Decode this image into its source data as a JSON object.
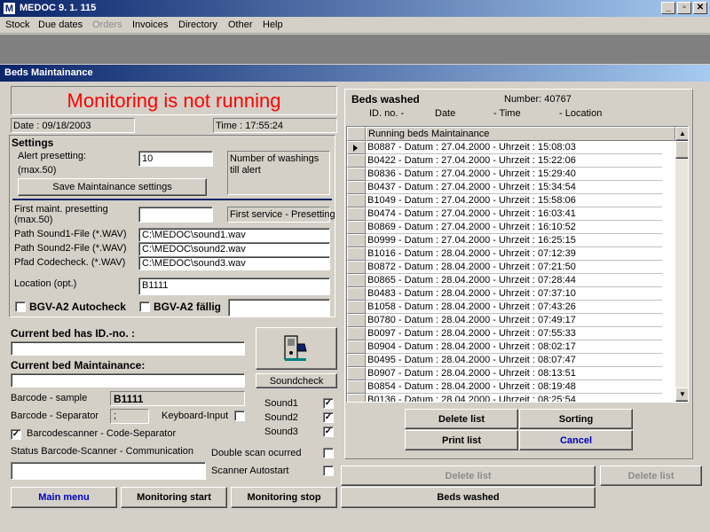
{
  "app": {
    "title": "MEDOC    9. 1. 115",
    "icon": "medoc-app-icon"
  },
  "window_controls": {
    "minimize": "_",
    "maximize": "▫",
    "close": "✕"
  },
  "menu": [
    "Stock",
    "Due dates",
    "Orders",
    "Invoices",
    "Directory",
    "Other",
    "Help"
  ],
  "menu_disabled": [
    "Orders"
  ],
  "form_title": "Beds Maintainance",
  "monitor_status": "Monitoring is not running",
  "monitor_status_color": "#ff0000",
  "date": "Date : 09/18/2003",
  "time": "Time : 17:55:24",
  "settings": {
    "header": "Settings",
    "alert_label_1": "Alert presetting:",
    "alert_label_2": "(max.50)",
    "alert_value": "10",
    "alert_note": "Number of washings till alert",
    "save_button": "Save Maintainance settings",
    "first_maint_label_1": "First maint. presetting",
    "first_maint_label_2": "(max.50)",
    "first_maint_value": "",
    "first_service_note": "First service - Presetting",
    "sound1_label": "Path Sound1-File (*.WAV)",
    "sound1_value": "C:\\MEDOC\\sound1.wav",
    "sound2_label": "Path Sound2-File (*.WAV)",
    "sound2_value": "C:\\MEDOC\\sound2.wav",
    "codecheck_label": "Pfad Codecheck. (*.WAV)",
    "codecheck_value": "C:\\MEDOC\\sound3.wav",
    "location_label": "Location (opt.)",
    "location_value": "B1111",
    "bgv_autocheck": "BGV-A2 Autocheck",
    "bgv_faellig": "BGV-A2 fällig",
    "bgv_faellig_value": ""
  },
  "current": {
    "bed_id_label": "Current bed has ID.-no. :",
    "bed_id_value": "",
    "maint_label": "Current bed Maintainance:",
    "maint_value": "",
    "soundcheck_button": "Soundcheck",
    "barcode_sample_label": "Barcode - sample",
    "barcode_sample_value": "B1111",
    "barcode_sep_label": "Barcode - Separator",
    "barcode_sep_value": ";",
    "keyboard_input_label": "Keyboard-Input",
    "barcodescanner_label": "Barcodescanner - Code-Separator",
    "sound1": "Sound1",
    "sound2": "Sound2",
    "sound3": "Sound3",
    "status_label": "Status Barcode-Scanner - Communication",
    "status_value": "",
    "double_scan_label": "Double scan ocurred",
    "scanner_autostart_label": "Scanner Autostart"
  },
  "bottom_buttons": {
    "main_menu": "Main menu",
    "monitoring_start": "Monitoring start",
    "monitoring_stop": "Monitoring stop",
    "beds_washed": "Beds washed",
    "delete_list_1": "Delete list",
    "delete_list_2": "Delete list"
  },
  "washed": {
    "header": "Beds washed",
    "number_label": "Number: 40767",
    "col_id": "ID. no. -",
    "col_date": "Date",
    "col_time": "- Time",
    "col_location": "- Location",
    "list_header": "Running beds Maintainance",
    "rows": [
      "B0887 - Datum : 27.04.2000 - Uhrzeit : 15:08:03",
      "B0422 - Datum : 27.04.2000 - Uhrzeit : 15:22:06",
      "B0836 - Datum : 27.04.2000 - Uhrzeit : 15:29:40",
      "B0437 - Datum : 27.04.2000 - Uhrzeit : 15:34:54",
      "B1049 - Datum : 27.04.2000 - Uhrzeit : 15:58:06",
      "B0474 - Datum : 27.04.2000 - Uhrzeit : 16:03:41",
      "B0869 - Datum : 27.04.2000 - Uhrzeit : 16:10:52",
      "B0999 - Datum : 27.04.2000 - Uhrzeit : 16:25:15",
      "B1016 - Datum : 28.04.2000 - Uhrzeit : 07:12:39",
      "B0872 - Datum : 28.04.2000 - Uhrzeit : 07:21:50",
      "B0865 - Datum : 28.04.2000 - Uhrzeit : 07:28:44",
      "B0483 - Datum : 28.04.2000 - Uhrzeit : 07:37:10",
      "B1058 - Datum : 28.04.2000 - Uhrzeit : 07:43:26",
      "B0780 - Datum : 28.04.2000 - Uhrzeit : 07:49:17",
      "B0097 - Datum : 28.04.2000 - Uhrzeit : 07:55:33",
      "B0904 - Datum : 28.04.2000 - Uhrzeit : 08:02:17",
      "B0495 - Datum : 28.04.2000 - Uhrzeit : 08:07:47",
      "B0907 - Datum : 28.04.2000 - Uhrzeit : 08:13:51",
      "B0854 - Datum : 28.04.2000 - Uhrzeit : 08:19:48",
      "B0136 - Datum : 28.04.2000 - Uhrzeit : 08:25:54"
    ],
    "delete_button": "Delete list",
    "sorting_button": "Sorting",
    "print_button": "Print list",
    "cancel_button": "Cancel"
  }
}
